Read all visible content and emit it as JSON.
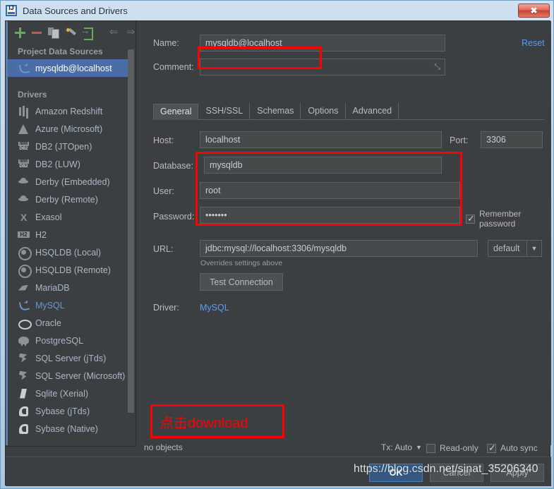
{
  "window": {
    "title": "Data Sources and Drivers",
    "app_icon": "intellij-idea-icon",
    "close_label": "✖"
  },
  "toolbar": {
    "items": [
      {
        "name": "add-icon",
        "glyph": "+"
      },
      {
        "name": "remove-icon",
        "glyph": "−"
      },
      {
        "name": "copy-icon",
        "glyph": ""
      },
      {
        "name": "wrench-icon",
        "glyph": ""
      },
      {
        "name": "import-icon",
        "glyph": ""
      },
      {
        "name": "back-arrow-icon",
        "glyph": "⇐"
      },
      {
        "name": "forward-arrow-icon",
        "glyph": "⇒"
      }
    ]
  },
  "sidebar": {
    "project_header": "Project Data Sources",
    "data_sources": [
      {
        "label": "mysqldb@localhost",
        "icon": "mysql-icon",
        "selected": true
      }
    ],
    "drivers_header": "Drivers",
    "drivers": [
      {
        "label": "Amazon Redshift",
        "icon": "redshift-icon"
      },
      {
        "label": "Azure (Microsoft)",
        "icon": "azure-icon"
      },
      {
        "label": "DB2 (JTOpen)",
        "icon": "db2-icon"
      },
      {
        "label": "DB2 (LUW)",
        "icon": "db2-icon"
      },
      {
        "label": "Derby (Embedded)",
        "icon": "derby-icon"
      },
      {
        "label": "Derby (Remote)",
        "icon": "derby-icon"
      },
      {
        "label": "Exasol",
        "icon": "exasol-icon"
      },
      {
        "label": "H2",
        "icon": "h2-icon"
      },
      {
        "label": "HSQLDB (Local)",
        "icon": "hsqldb-icon"
      },
      {
        "label": "HSQLDB (Remote)",
        "icon": "hsqldb-icon"
      },
      {
        "label": "MariaDB",
        "icon": "mariadb-icon"
      },
      {
        "label": "MySQL",
        "icon": "mysql-icon",
        "active": true
      },
      {
        "label": "Oracle",
        "icon": "oracle-icon"
      },
      {
        "label": "PostgreSQL",
        "icon": "postgresql-icon"
      },
      {
        "label": "SQL Server (jTds)",
        "icon": "sqlserver-icon"
      },
      {
        "label": "SQL Server (Microsoft)",
        "icon": "sqlserver-icon"
      },
      {
        "label": "Sqlite (Xerial)",
        "icon": "sqlite-icon"
      },
      {
        "label": "Sybase (jTds)",
        "icon": "sybase-icon"
      },
      {
        "label": "Sybase (Native)",
        "icon": "sybase-icon"
      }
    ],
    "help_icon": "?"
  },
  "form": {
    "name_label": "Name:",
    "name_value": "mysqldb@localhost",
    "reset_label": "Reset",
    "comment_label": "Comment:",
    "comment_value": "",
    "comment_expand_icon": "expand-icon",
    "host_label": "Host:",
    "host_value": "localhost",
    "port_label": "Port:",
    "port_value": "3306",
    "database_label": "Database:",
    "database_value": "mysqldb",
    "user_label": "User:",
    "user_value": "root",
    "password_label": "Password:",
    "password_value": "•••••••",
    "remember_password_label": "Remember password",
    "remember_password_checked": true,
    "url_label": "URL:",
    "url_value": "jdbc:mysql://localhost:3306/mysqldb",
    "url_mode": "default",
    "url_mode_arrow": "chevron-down-icon",
    "overrides_note": "Overrides settings above",
    "test_connection_label": "Test Connection",
    "driver_label": "Driver:",
    "driver_value": "MySQL"
  },
  "tabs": [
    {
      "label": "General",
      "active": true
    },
    {
      "label": "SSH/SSL",
      "active": false
    },
    {
      "label": "Schemas",
      "active": false
    },
    {
      "label": "Options",
      "active": false
    },
    {
      "label": "Advanced",
      "active": false
    }
  ],
  "status": {
    "no_objects": "no objects",
    "tx_label": "Tx: Auto",
    "tx_arrow": "chevron-down-icon",
    "read_only_label": "Read-only",
    "read_only_checked": false,
    "auto_sync_label": "Auto sync",
    "auto_sync_checked": true
  },
  "buttons": {
    "ok": "OK",
    "cancel": "Cancel",
    "apply": "Apply"
  },
  "annotation": {
    "text": "点击download",
    "color": "#ff0000"
  },
  "watermark": "https://blog.csdn.net/sinat_35206340",
  "colors": {
    "dialog_bg": "#3c3f41",
    "field_bg": "#45494a",
    "selection": "#4a6da7",
    "link": "#589df6",
    "accent_ok": "#365880",
    "annotation_red": "#ff0000"
  }
}
